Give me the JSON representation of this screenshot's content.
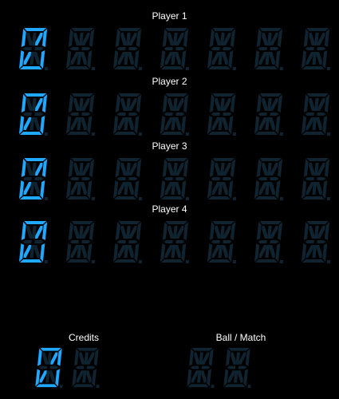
{
  "players": [
    {
      "label": "Player 1",
      "score": "0"
    },
    {
      "label": "Player 2",
      "score": "0"
    },
    {
      "label": "Player 3",
      "score": "0"
    },
    {
      "label": "Player 4",
      "score": "0"
    }
  ],
  "credits": {
    "label": "Credits",
    "value": "0"
  },
  "ball_match": {
    "label": "Ball / Match",
    "value": ""
  },
  "colors": {
    "segment_on": "#1ea8ff",
    "segment_off": "#0f2430",
    "background": "#000000",
    "label_text": "#ffffff"
  }
}
